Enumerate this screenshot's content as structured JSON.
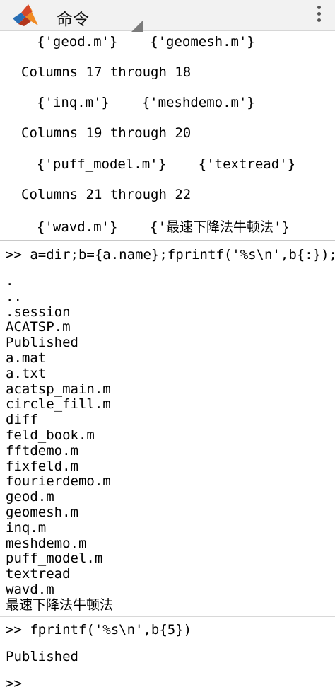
{
  "app": {
    "title": "命令"
  },
  "colors": {
    "appbar_bg": "#f2f2f2",
    "logo_red": "#d6482a",
    "logo_blue": "#2a6fb5",
    "logo_orange": "#f08a24"
  },
  "previous_output": {
    "row_geod": "{'geod.m'}    {'geomesh.m'}",
    "cols_17": "Columns 17 through 18",
    "row_17": "{'inq.m'}    {'meshdemo.m'}",
    "cols_19": "Columns 19 through 20",
    "row_19": "{'puff_model.m'}    {'textread'}",
    "cols_21": "Columns 21 through 22",
    "row_21": "{'wavd.m'}    {'最速下降法牛顿法'}"
  },
  "command1": {
    "text": ">> a=dir;b={a.name};fprintf('%s\\n',b{:});"
  },
  "listing": [
    ".",
    "..",
    ".session",
    "ACATSP.m",
    "Published",
    "a.mat",
    "a.txt",
    "acatsp_main.m",
    "circle_fill.m",
    "diff",
    "feld_book.m",
    "fftdemo.m",
    "fixfeld.m",
    "fourierdemo.m",
    "geod.m",
    "geomesh.m",
    "inq.m",
    "meshdemo.m",
    "puff_model.m",
    "textread",
    "wavd.m",
    "最速下降法牛顿法"
  ],
  "command2": {
    "text": ">> fprintf('%s\\n',b{5})",
    "output": "Published"
  },
  "prompt": {
    "text": ">>"
  }
}
